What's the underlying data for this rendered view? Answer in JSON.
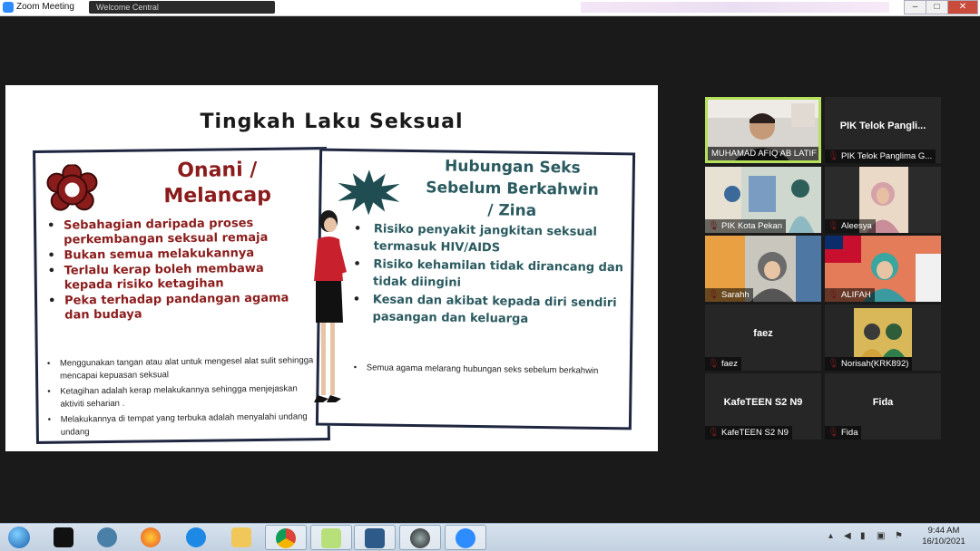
{
  "window": {
    "title": "Zoom Meeting",
    "tab_text": "Welcome Central",
    "controls": {
      "minimize": "–",
      "restore": "□",
      "close": "✕"
    }
  },
  "slide": {
    "title": "Tingkah Laku Seksual",
    "left": {
      "heading": "Onani / Melancap",
      "heading_line1": "Onani /",
      "heading_line2": "Melancap",
      "bullets": [
        "Sebahagian daripada proses perkembangan seksual remaja",
        "Bukan semua melakukannya",
        "Terlalu kerap boleh membawa kepada risiko ketagihan",
        "Peka terhadap pandangan agama dan budaya"
      ],
      "notes": [
        "Menggunakan tangan atau alat untuk mengesel alat sulit sehingga mencapai kepuasan seksual",
        "Ketagihan adalah kerap melakukannya sehingga menjejaskan aktiviti seharian .",
        "Melakukannya di tempat yang terbuka adalah menyalahi undang undang"
      ]
    },
    "right": {
      "heading_line1": "Hubungan Seks",
      "heading_line2": "Sebelum Berkahwin",
      "heading_line3": "/ Zina",
      "bullets": [
        "Risiko penyakit jangkitan seksual termasuk HIV/AIDS",
        "Risiko kehamilan tidak dirancang dan tidak diingini",
        "Kesan dan akibat kepada diri sendiri pasangan dan keluarga"
      ],
      "notes": [
        "Semua agama melarang hubungan seks sebelum berkahwin"
      ]
    },
    "colors": {
      "left_accent": "#8b1c1c",
      "right_accent": "#2a5a5f",
      "frame": "#1f2740"
    }
  },
  "participants": [
    {
      "name": "MUHAMAD AFIQ AB LATIF",
      "video": true,
      "active": true
    },
    {
      "name": "PIK Telok Panglima G...",
      "display": "PIK Telok Pangli...",
      "video": false
    },
    {
      "name": "PIK Kota Pekan",
      "video": true
    },
    {
      "name": "Aleesya",
      "video": true
    },
    {
      "name": "Sarahh",
      "video": true
    },
    {
      "name": "ALIFAH",
      "video": true
    },
    {
      "name": "faez",
      "display": "faez",
      "video": false
    },
    {
      "name": "Norisah(KRK892)",
      "video": true
    },
    {
      "name": "KafeTEEN S2 N9",
      "display": "KafeTEEN S2 N9",
      "video": false
    },
    {
      "name": "Fida",
      "display": "Fida",
      "video": false
    }
  ],
  "taskbar": {
    "time": "9:44 AM",
    "date": "16/10/2021",
    "apps": [
      "start-orb",
      "dreamweaver",
      "network-app",
      "firefox",
      "internet-explorer",
      "file-explorer",
      "chrome",
      "sticky-notes",
      "remote-desktop",
      "camera",
      "zoom"
    ]
  }
}
